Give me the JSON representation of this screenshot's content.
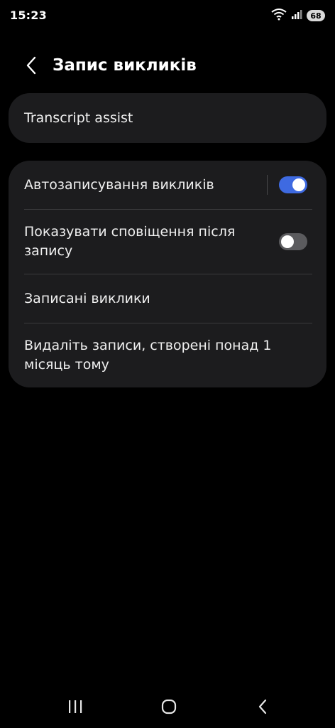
{
  "status_bar": {
    "time": "15:23",
    "battery": "68",
    "icons": [
      "wifi-icon",
      "signal-icon",
      "battery-icon"
    ]
  },
  "header": {
    "title": "Запис викликів",
    "back_icon": "chevron-left-icon"
  },
  "card1": {
    "item": "Transcript assist"
  },
  "card2": {
    "auto_record": {
      "label": "Автозаписування викликів",
      "enabled": true
    },
    "show_notification": {
      "label_line1": "Показувати сповіщення після",
      "label_line2": "запису",
      "enabled": false
    },
    "recorded_calls": {
      "label": "Записані виклики"
    },
    "delete_old": {
      "label_line1": "Видаліть записи, створені понад 1",
      "label_line2": "місяць тому"
    }
  },
  "nav_bar": {
    "icons": [
      "recents-icon",
      "home-icon",
      "back-icon"
    ]
  },
  "colors": {
    "background": "#000000",
    "card": "#1c1c1e",
    "accent": "#3e6ae1",
    "toggle_off": "#5b5b5e"
  }
}
